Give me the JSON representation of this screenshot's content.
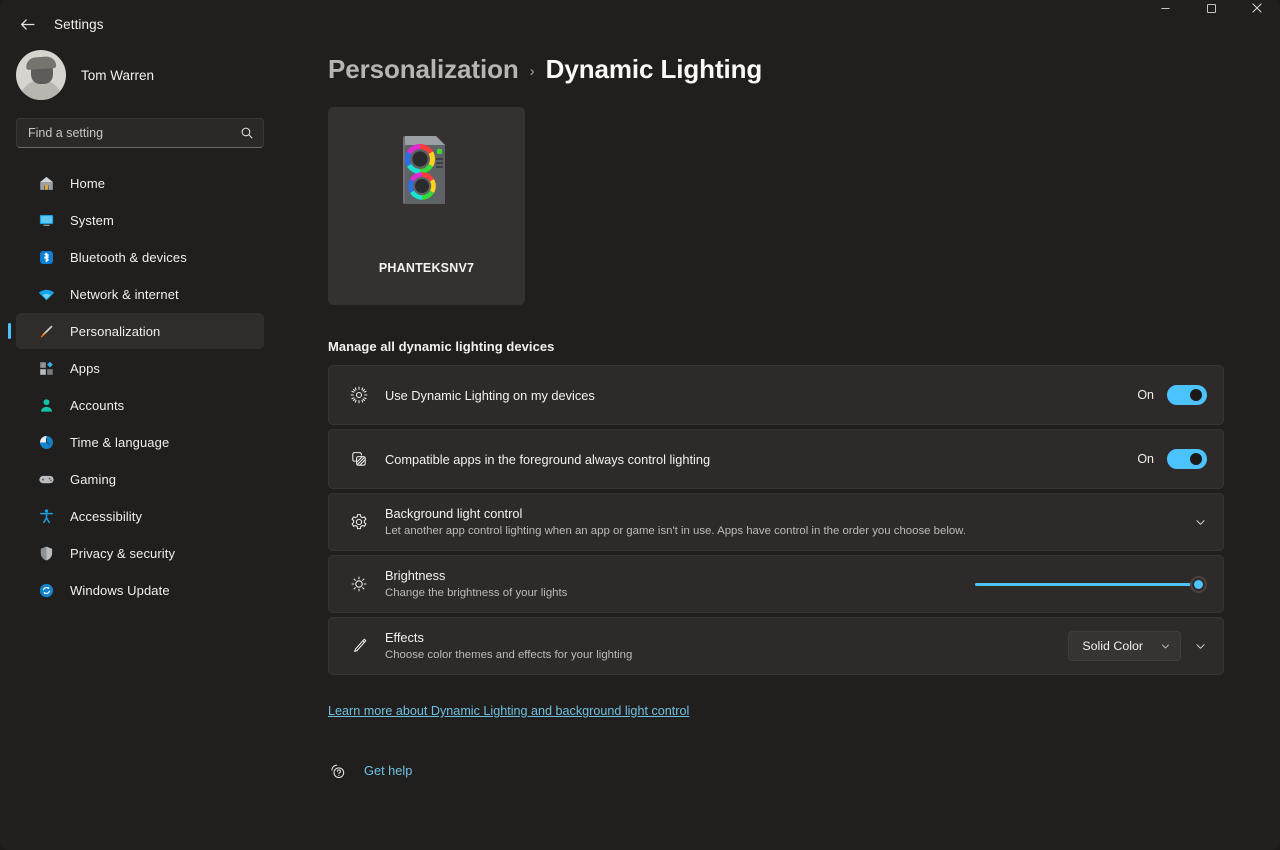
{
  "window": {
    "title": "Settings",
    "back_icon": "back-arrow-icon",
    "minimize_label": "Minimize",
    "maximize_label": "Maximize",
    "close_label": "Close"
  },
  "sidebar": {
    "account": {
      "name": "Tom Warren",
      "avatar_icon": "user-avatar"
    },
    "search": {
      "value": "",
      "placeholder": "Find a setting",
      "icon": "search-icon"
    },
    "items": [
      {
        "label": "Home",
        "icon": "home-icon",
        "selected": false
      },
      {
        "label": "System",
        "icon": "system-icon",
        "selected": false
      },
      {
        "label": "Bluetooth & devices",
        "icon": "bluetooth-icon",
        "selected": false
      },
      {
        "label": "Network & internet",
        "icon": "wifi-icon",
        "selected": false
      },
      {
        "label": "Personalization",
        "icon": "paintbrush-icon",
        "selected": true
      },
      {
        "label": "Apps",
        "icon": "apps-icon",
        "selected": false
      },
      {
        "label": "Accounts",
        "icon": "accounts-icon",
        "selected": false
      },
      {
        "label": "Time & language",
        "icon": "clock-icon",
        "selected": false
      },
      {
        "label": "Gaming",
        "icon": "gamepad-icon",
        "selected": false
      },
      {
        "label": "Accessibility",
        "icon": "accessibility-icon",
        "selected": false
      },
      {
        "label": "Privacy & security",
        "icon": "shield-icon",
        "selected": false
      },
      {
        "label": "Windows Update",
        "icon": "update-icon",
        "selected": false
      }
    ]
  },
  "main": {
    "breadcrumb": {
      "parent": "Personalization",
      "separator": "›",
      "current": "Dynamic Lighting"
    },
    "device": {
      "name": "PHANTEKSNV7",
      "icon": "rgb-pc-tower-icon"
    },
    "section_title": "Manage all dynamic lighting devices",
    "rows": [
      {
        "title": "Use Dynamic Lighting on my devices",
        "description": "",
        "icon": "sun-rays-icon",
        "control": "toggle",
        "toggle_state": "On"
      },
      {
        "title": "Compatible apps in the foreground always control lighting",
        "description": "",
        "icon": "apps-overlap-icon",
        "control": "toggle",
        "toggle_state": "On"
      },
      {
        "title": "Background light control",
        "description": "Let another app control lighting when an app or game isn't in use. Apps have control in the order you choose below.",
        "icon": "gear-icon",
        "control": "expander",
        "toggle_state": ""
      },
      {
        "title": "Brightness",
        "description": "Change the brightness of your lights",
        "icon": "brightness-icon",
        "control": "slider",
        "slider_value": 100,
        "toggle_state": ""
      },
      {
        "title": "Effects",
        "description": "Choose color themes and effects for your lighting",
        "icon": "effects-brush-icon",
        "control": "dropdown",
        "dropdown_value": "Solid Color",
        "toggle_state": ""
      }
    ],
    "learn_more": "Learn more about Dynamic Lighting and background light control",
    "get_help": {
      "label": "Get help",
      "icon": "help-icon"
    }
  },
  "colors": {
    "accent": "#4cc2ff",
    "link": "#6fc0e0",
    "page_bg": "#211f1e",
    "card_bg": "#2e2a29",
    "device_card_bg": "#343130"
  }
}
